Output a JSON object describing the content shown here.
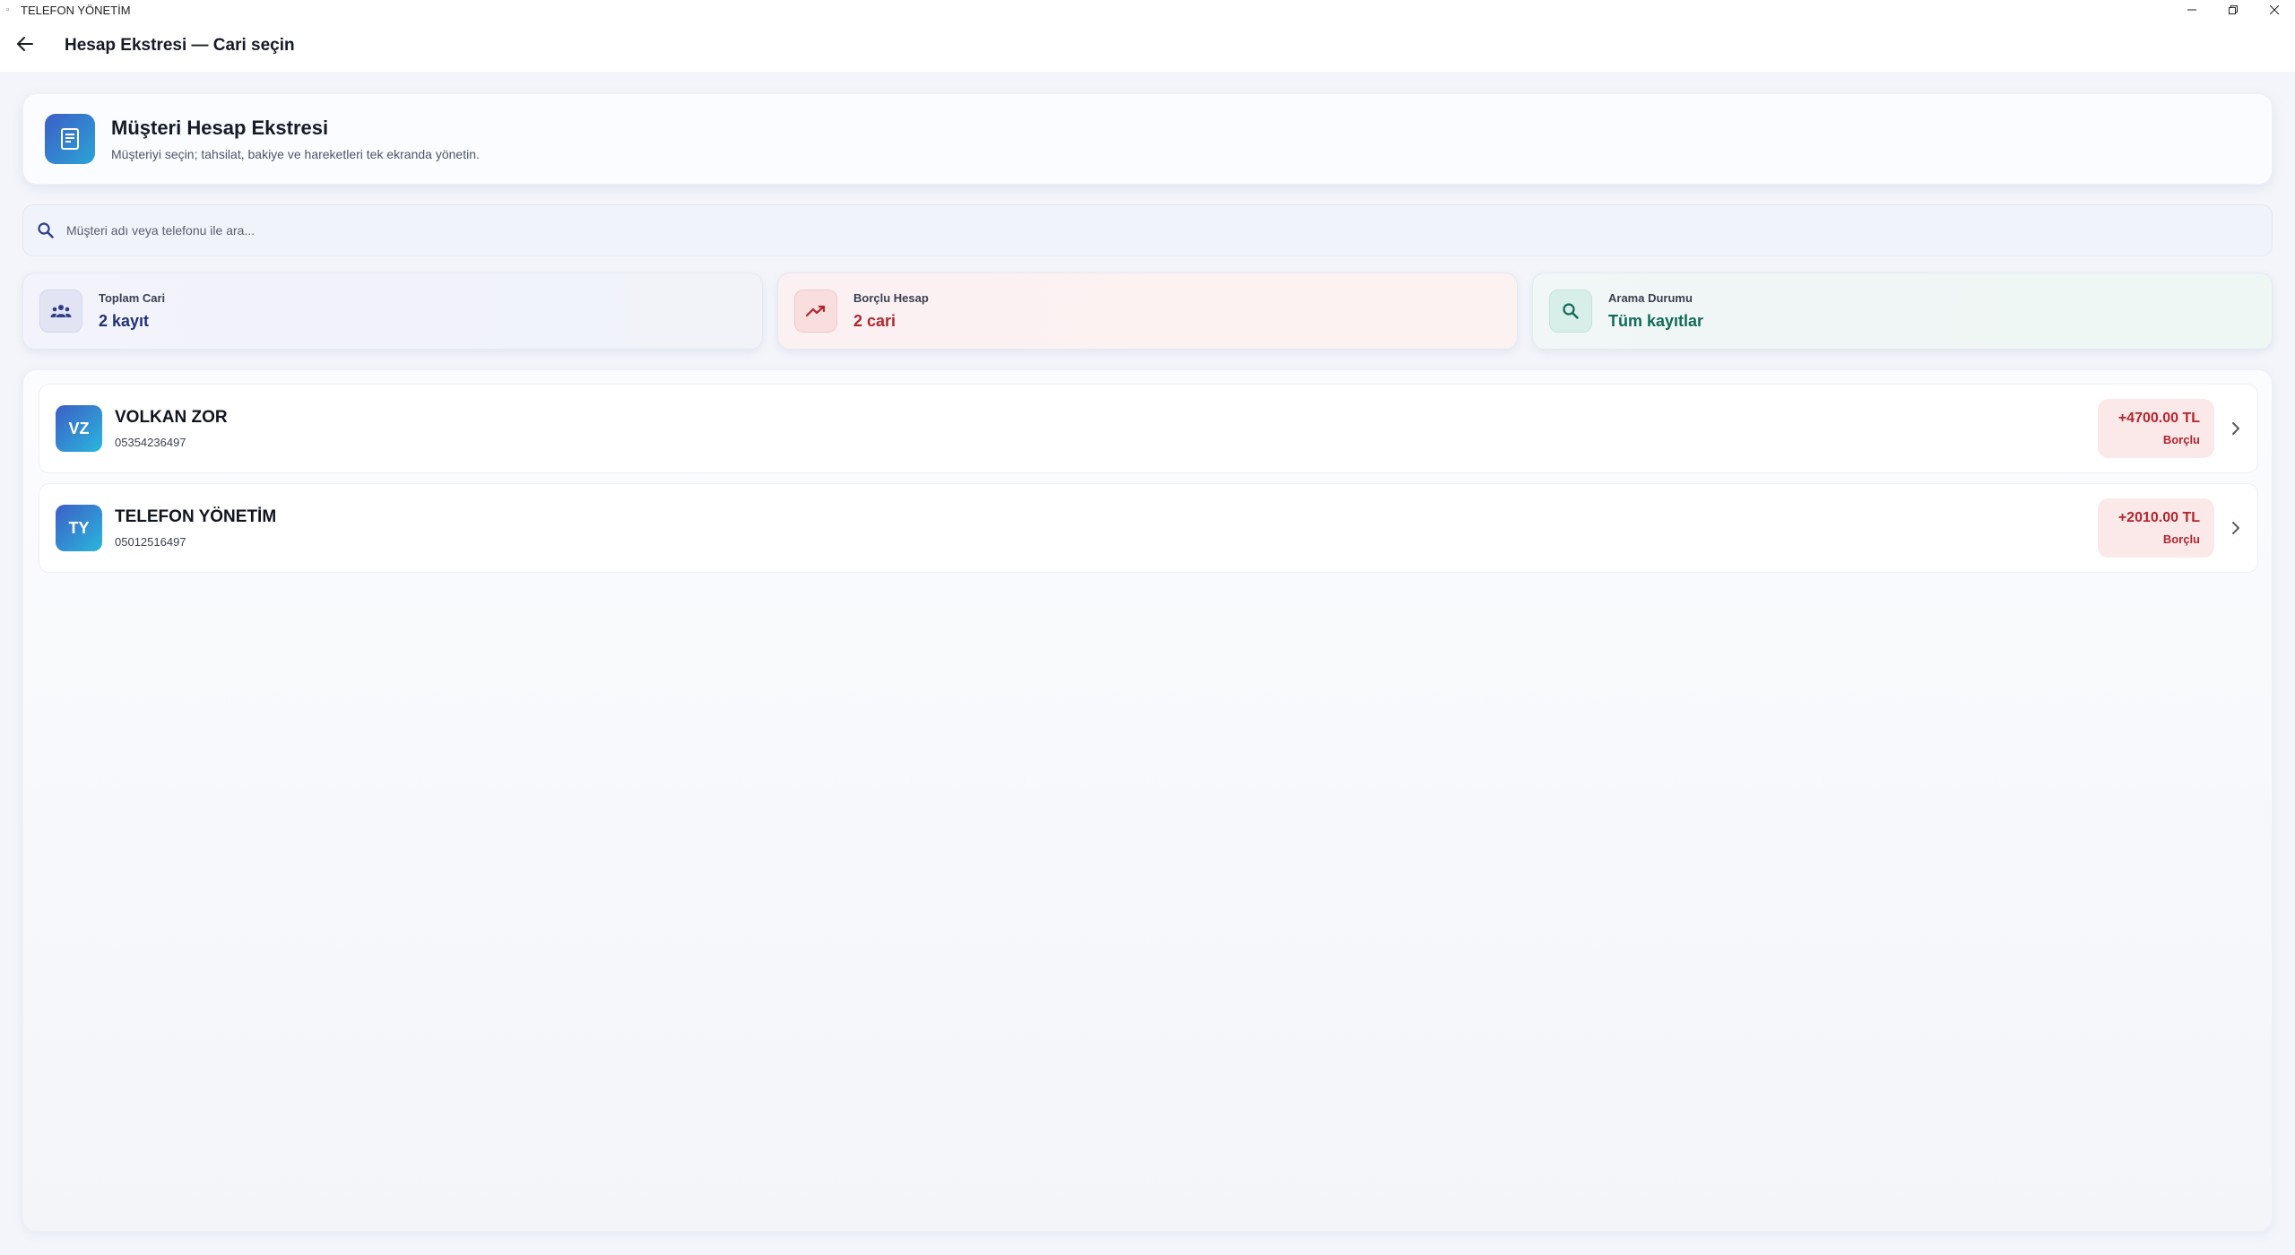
{
  "window": {
    "title": "TELEFON YÖNETİM",
    "controls": [
      "minimize",
      "restore",
      "close"
    ]
  },
  "appbar": {
    "title": "Hesap Ekstresi — Cari seçin",
    "back_icon": "arrow-left-icon"
  },
  "header": {
    "title": "Müşteri Hesap Ekstresi",
    "subtitle": "Müşteriyi seçin; tahsilat, bakiye ve hareketleri tek ekranda yönetin.",
    "icon": "receipt-icon"
  },
  "search": {
    "placeholder": "Müşteri adı veya telefonu ile ara...",
    "value": ""
  },
  "stats": [
    {
      "label": "Toplam Cari",
      "value": "2 kayıt",
      "icon": "group-icon",
      "color": "#22317a"
    },
    {
      "label": "Borçlu Hesap",
      "value": "2 cari",
      "icon": "trending-up-icon",
      "color": "#b1262e"
    },
    {
      "label": "Arama Durumu",
      "value": "Tüm kayıtlar",
      "icon": "search-icon",
      "color": "#116a58"
    }
  ],
  "customers": [
    {
      "initials": "VZ",
      "name": "VOLKAN ZOR",
      "phone": "05354236497",
      "balance": "+4700.00 TL",
      "status": "Borçlu"
    },
    {
      "initials": "TY",
      "name": "TELEFON YÖNETİM",
      "phone": "05012516497",
      "balance": "+2010.00 TL",
      "status": "Borçlu"
    }
  ],
  "colors": {
    "accent_gradient_start": "#3d5ec7",
    "accent_gradient_end": "#29b7dc",
    "debt_red": "#b1262e",
    "debt_badge_bg": "#fbe8e8"
  }
}
